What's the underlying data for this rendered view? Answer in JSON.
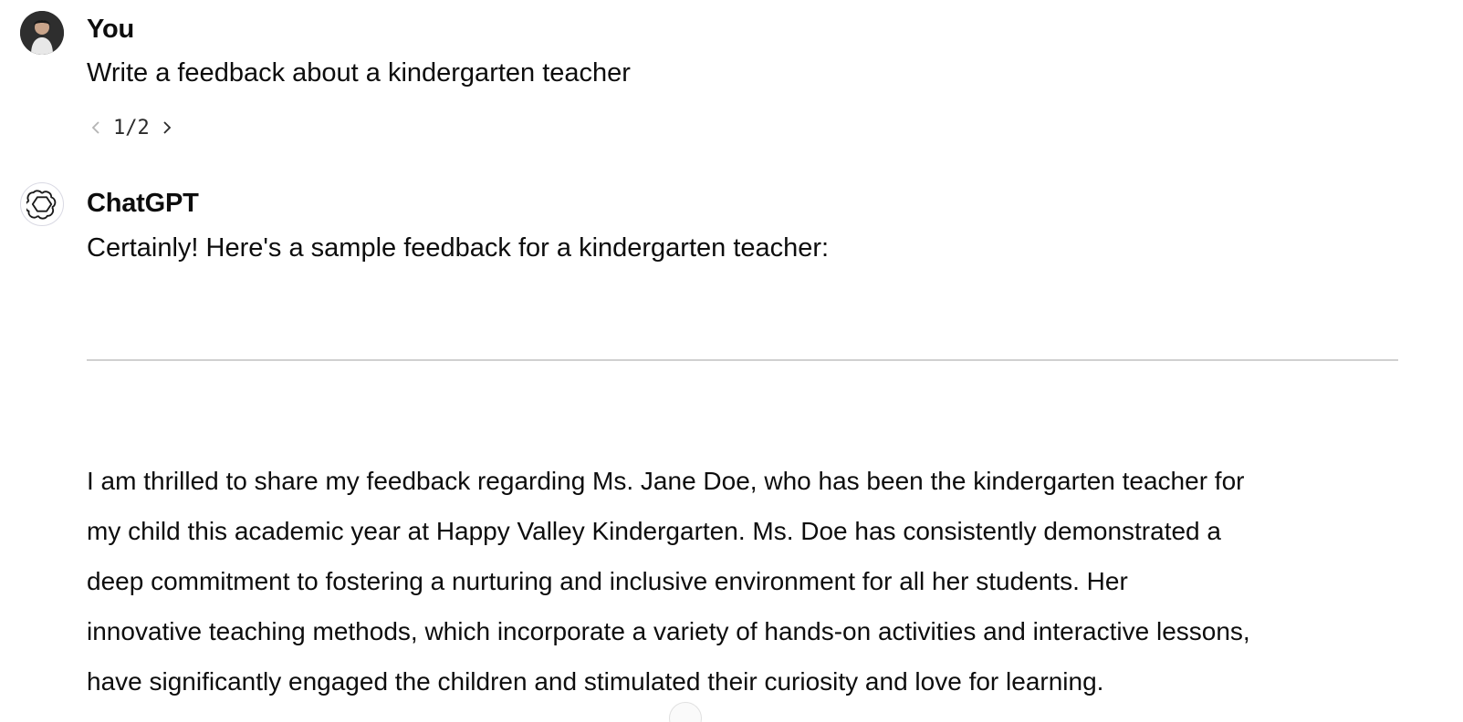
{
  "user_turn": {
    "author": "You",
    "message": "Write a feedback about a kindergarten teacher",
    "pager": {
      "label": "1/2",
      "prev_icon": "chevron-left-icon",
      "next_icon": "chevron-right-icon"
    },
    "avatar_icon": "user-avatar"
  },
  "assistant_turn": {
    "author": "ChatGPT",
    "avatar_icon": "openai-logo-icon",
    "intro": "Certainly! Here's a sample feedback for a kindergarten teacher:",
    "body_lines": [
      "I am thrilled to share my feedback regarding Ms. Jane Doe, who has been the kindergarten teacher for",
      "my child this academic year at Happy Valley Kindergarten. Ms. Doe has consistently demonstrated a",
      "deep commitment to fostering a nurturing and inclusive environment for all her students. Her",
      "innovative teaching methods, which incorporate a variety of hands-on activities and interactive lessons,",
      "have significantly engaged the children and stimulated their curiosity and love for learning."
    ]
  },
  "colors": {
    "text": "#0d0d0d",
    "divider": "#d0d0d0",
    "background": "#ffffff"
  }
}
